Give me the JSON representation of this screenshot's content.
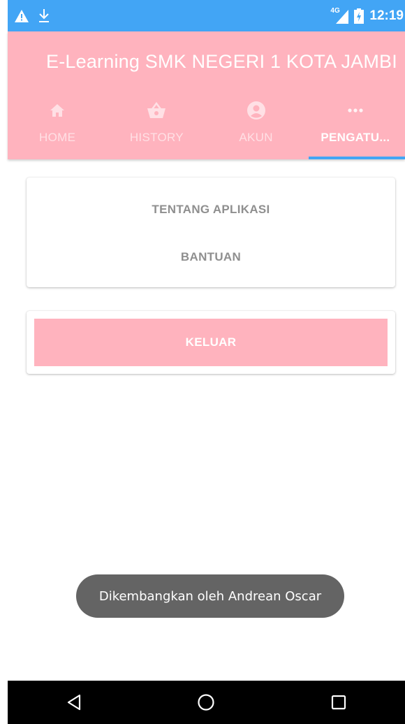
{
  "status_bar": {
    "network": "4G",
    "time": "12:19",
    "icons": [
      "warning-icon",
      "download-icon",
      "signal-icon",
      "battery-icon"
    ]
  },
  "app_bar": {
    "title": "E-Learning SMK NEGERI 1 KOTA JAMBI"
  },
  "tabs": [
    {
      "label": "HOME",
      "icon": "home-icon",
      "active": false
    },
    {
      "label": "HISTORY",
      "icon": "basket-icon",
      "active": false
    },
    {
      "label": "AKUN",
      "icon": "account-icon",
      "active": false
    },
    {
      "label": "PENGATU...",
      "icon": "more-icon",
      "active": true
    }
  ],
  "settings_menu": {
    "about_label": "TENTANG APLIKASI",
    "help_label": "BANTUAN"
  },
  "logout": {
    "label": "KELUAR"
  },
  "toast": {
    "message": "Dikembangkan oleh Andrean Oscar"
  },
  "nav_bar": {
    "icons": [
      "back-icon",
      "home-circle-icon",
      "recents-icon"
    ]
  },
  "colors": {
    "status_bar": "#42a5f5",
    "app_bar": "#ffb3be",
    "tab_indicator": "#42a5f5",
    "logout_button": "#ffb3be",
    "toast_bg": "#646464",
    "menu_text": "#8f8f8f"
  }
}
